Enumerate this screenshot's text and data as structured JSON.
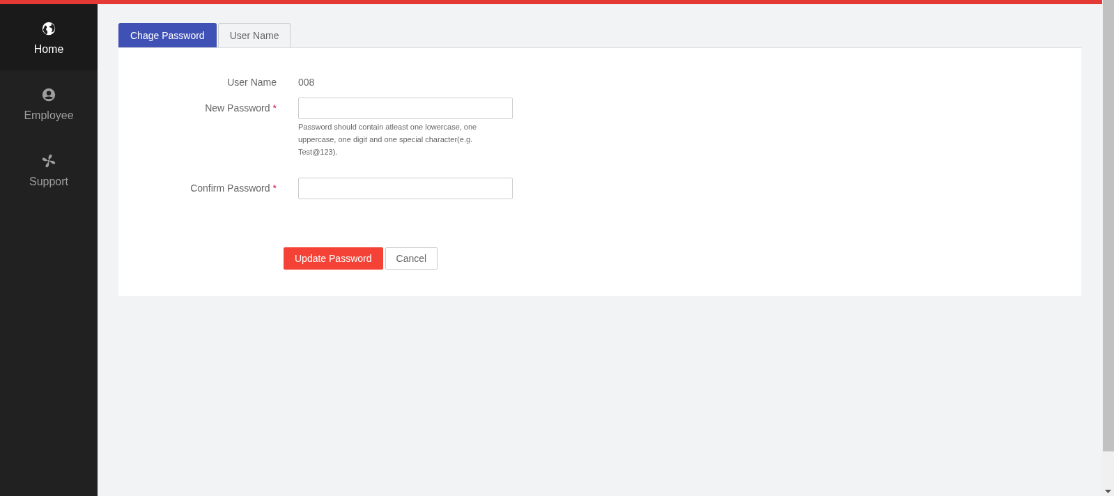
{
  "sidebar": {
    "items": [
      {
        "label": "Home",
        "kind": "globe",
        "selected": true
      },
      {
        "label": "Employee",
        "kind": "user",
        "selected": false
      },
      {
        "label": "Support",
        "kind": "fan",
        "selected": false
      }
    ]
  },
  "tabs": [
    {
      "label": "Chage Password",
      "selected": true
    },
    {
      "label": "User Name",
      "selected": false
    }
  ],
  "form": {
    "fields": [
      {
        "kind": "static",
        "label": "User Name",
        "value": "008"
      },
      {
        "kind": "password",
        "label": "New Password",
        "required_mark": "*",
        "help": "Password should contain atleast one lowercase, one uppercase, one digit and one special character(e.g. Test@123)."
      },
      {
        "kind": "password",
        "label": "Confirm Password",
        "required_mark": "*"
      }
    ],
    "buttons": [
      {
        "label": "Update Password",
        "kind": "primary"
      },
      {
        "label": "Cancel",
        "kind": "secondary"
      }
    ]
  }
}
